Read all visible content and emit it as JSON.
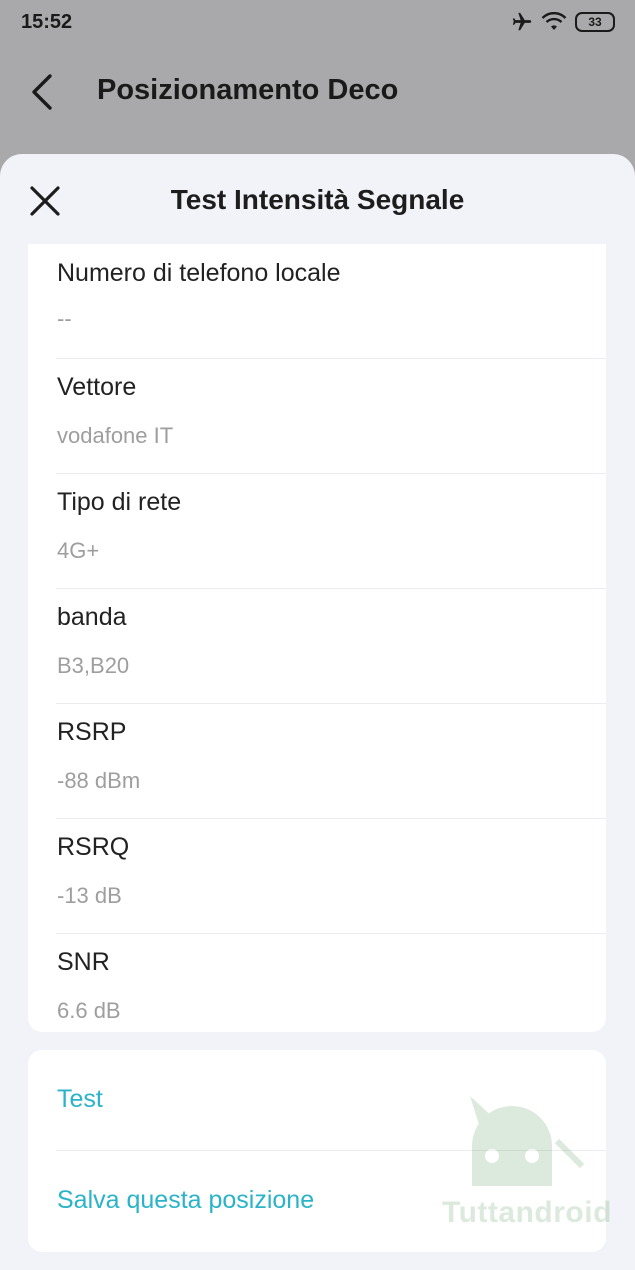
{
  "status_bar": {
    "time": "15:52",
    "battery": "33",
    "icons": [
      "airplane-icon",
      "wifi-icon",
      "battery-icon"
    ]
  },
  "header": {
    "title": "Posizionamento Deco",
    "back_icon": "chevron-left-icon"
  },
  "sheet": {
    "title": "Test Intensità Segnale",
    "close_icon": "close-icon",
    "info_rows": [
      {
        "label": "Numero di telefono locale",
        "value": "--"
      },
      {
        "label": "Vettore",
        "value": "vodafone IT"
      },
      {
        "label": "Tipo di rete",
        "value": "4G+"
      },
      {
        "label": "banda",
        "value": "B3,B20"
      },
      {
        "label": "RSRP",
        "value": "-88 dBm"
      },
      {
        "label": "RSRQ",
        "value": "-13 dB"
      },
      {
        "label": "SNR",
        "value": "6.6 dB"
      }
    ],
    "actions": [
      {
        "label": "Test"
      },
      {
        "label": "Salva questa posizione"
      }
    ]
  },
  "watermark": {
    "text": "Tuttandroid"
  },
  "colors": {
    "accent": "#2ab3c9",
    "sheet_bg": "#f2f3f8",
    "overlay": "#a9a9ab"
  }
}
